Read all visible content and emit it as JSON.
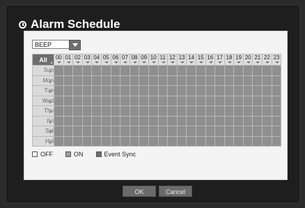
{
  "dialog": {
    "title": "Alarm Schedule"
  },
  "alarm_type": {
    "selected": "BEEP"
  },
  "grid": {
    "all_label": "All",
    "hours": [
      "00",
      "01",
      "02",
      "03",
      "04",
      "05",
      "06",
      "07",
      "08",
      "09",
      "10",
      "11",
      "12",
      "13",
      "14",
      "15",
      "16",
      "17",
      "18",
      "19",
      "20",
      "21",
      "22",
      "23"
    ],
    "days": [
      "Sun",
      "Mon",
      "Tue",
      "Wed",
      "Thu",
      "Fri",
      "Sat",
      "Hol"
    ],
    "cell_state": "ON"
  },
  "legend": {
    "off": "OFF",
    "on": "ON",
    "event_sync": "Event Sync"
  },
  "buttons": {
    "ok": "OK",
    "cancel": "Cancel"
  },
  "colors": {
    "on": "#8f8f8f",
    "off": "#ffffff",
    "event_sync": "#6e6e6e",
    "header_all": "#6d6d6d"
  }
}
